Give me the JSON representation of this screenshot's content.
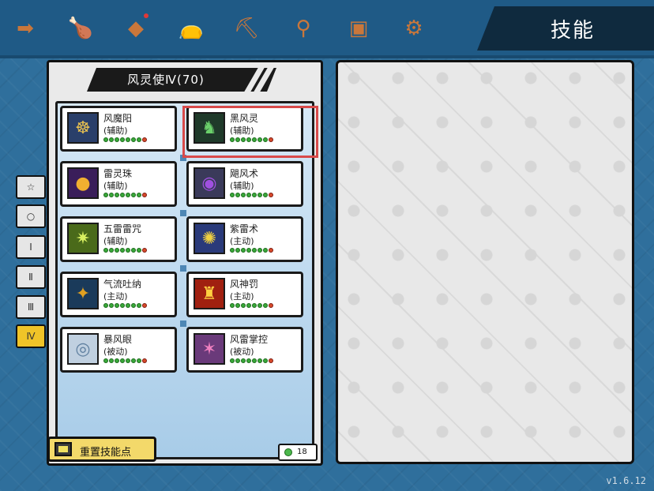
{
  "header": {
    "title": "技能",
    "tabs": [
      {
        "icon": "exit-arrow-icon",
        "glyph": "➡"
      },
      {
        "icon": "meat-icon",
        "glyph": "🍗"
      },
      {
        "icon": "crystal-icon",
        "glyph": "◆"
      },
      {
        "icon": "pouch-icon",
        "glyph": "👝"
      },
      {
        "icon": "pickaxe-icon",
        "glyph": "⛏"
      },
      {
        "icon": "wand-icon",
        "glyph": "⚲"
      },
      {
        "icon": "chest-icon",
        "glyph": "▣"
      },
      {
        "icon": "gear-icon",
        "glyph": "⚙"
      }
    ]
  },
  "class_title": "风灵使Ⅳ(70)",
  "side_tabs": [
    "☆",
    "○",
    "Ⅰ",
    "Ⅱ",
    "Ⅲ",
    "Ⅳ"
  ],
  "active_side_tab": "Ⅳ",
  "skills": [
    {
      "name": "风魔阳",
      "type": "(辅助)",
      "icon": "wind-demon-icon",
      "bg": "#2a3f6a",
      "glyph": "☸",
      "fg": "#e8c050"
    },
    {
      "name": "黑风灵",
      "type": "(辅助)",
      "icon": "black-wind-spirit-icon",
      "bg": "#1f3a2a",
      "glyph": "♞",
      "fg": "#6ad06a"
    },
    {
      "name": "雷灵珠",
      "type": "(辅助)",
      "icon": "thunder-orb-icon",
      "bg": "#3a1e5a",
      "glyph": "●",
      "fg": "#f0b030"
    },
    {
      "name": "飓风术",
      "type": "(辅助)",
      "icon": "hurricane-icon",
      "bg": "#3a3a5a",
      "glyph": "◉",
      "fg": "#a050e0"
    },
    {
      "name": "五雷雷咒",
      "type": "(辅助)",
      "icon": "five-thunder-icon",
      "bg": "#4a6a1a",
      "glyph": "✷",
      "fg": "#d8f060"
    },
    {
      "name": "紫雷术",
      "type": "(主动)",
      "icon": "purple-thunder-icon",
      "bg": "#2a3a7a",
      "glyph": "✺",
      "fg": "#f0d040"
    },
    {
      "name": "气流吐纳",
      "type": "(主动)",
      "icon": "airflow-icon",
      "bg": "#1a3a5a",
      "glyph": "✦",
      "fg": "#e0a020"
    },
    {
      "name": "风神罚",
      "type": "(主动)",
      "icon": "wind-god-punish-icon",
      "bg": "#a02010",
      "glyph": "♜",
      "fg": "#ffd040"
    },
    {
      "name": "暴风眼",
      "type": "(被动)",
      "icon": "storm-eye-icon",
      "bg": "#c0d0e0",
      "glyph": "◎",
      "fg": "#6080a0"
    },
    {
      "name": "风雷掌控",
      "type": "(被动)",
      "icon": "wind-thunder-control-icon",
      "bg": "#6a3a7a",
      "glyph": "✶",
      "fg": "#f080c0"
    }
  ],
  "selected_skill": "黑风灵",
  "reset_button": "重置技能点",
  "skill_points": "18",
  "version": "v1.6.12"
}
